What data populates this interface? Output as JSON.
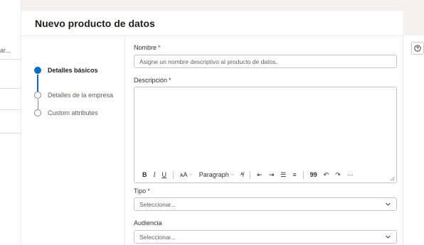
{
  "background": {
    "truncated_text": "ar..."
  },
  "panel": {
    "title": "Nuevo producto de datos"
  },
  "steps": [
    {
      "label": "Detalles básicos",
      "state": "active"
    },
    {
      "label": "Detalles de la empresa",
      "state": "pending"
    },
    {
      "label": "Custom attributes",
      "state": "pending"
    }
  ],
  "form": {
    "name": {
      "label": "Nombre",
      "required_mark": "*",
      "placeholder": "Asigne un nombre descriptivo al producto de datos."
    },
    "description": {
      "label": "Descripción",
      "required_mark": "*",
      "value": ""
    },
    "toolbar": {
      "bold": "B",
      "italic": "I",
      "underline": "U",
      "font_size": "ᴀA",
      "paragraph": "Paragraph",
      "clear_format": "ᴬ̸",
      "outdent": "⇤",
      "indent": "⇥",
      "bullets": "☰",
      "numbered": "≡",
      "quote": "99",
      "undo": "↶",
      "redo": "↷",
      "more": "···"
    },
    "type": {
      "label": "Tipo",
      "required_mark": "*",
      "value": "Seleccionar..."
    },
    "audience": {
      "label": "Audiencia",
      "value": "Seleccionar..."
    }
  },
  "colors": {
    "accent": "#0f6cbd",
    "required": "#a4262c",
    "border": "#c8c6c4"
  }
}
